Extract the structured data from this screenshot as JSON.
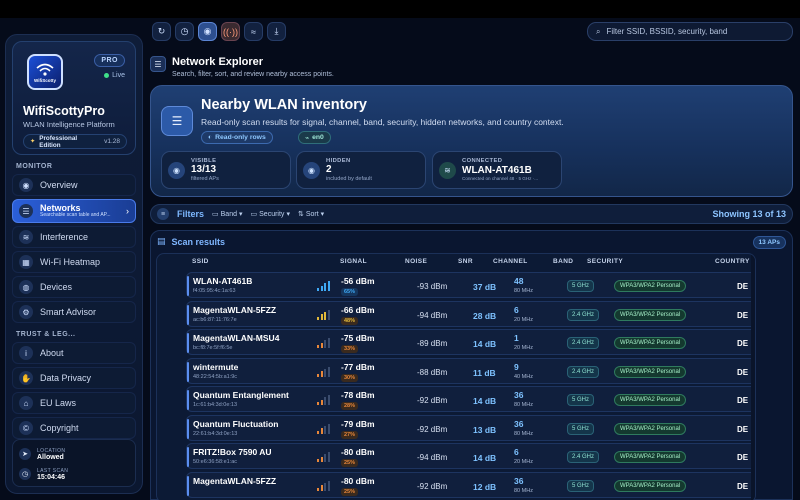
{
  "app": {
    "name": "WifiScottyPro",
    "subtitle": "WLAN Intelligence Platform",
    "icon_caption": "WifiScotty",
    "pro_badge": "PRO",
    "live": "Live",
    "edition": "Professional Edition",
    "version": "v1.28"
  },
  "sidebar": {
    "monitor_label": "MONITOR",
    "monitor_items": [
      {
        "label": "Overview",
        "icon": "eye-icon",
        "glyph": "◉"
      },
      {
        "label": "Networks",
        "sub": "Searchable scan table and AP...",
        "icon": "list-icon",
        "glyph": "☰",
        "active": true
      },
      {
        "label": "Interference",
        "icon": "wave-icon",
        "glyph": "≋"
      },
      {
        "label": "Wi-Fi Heatmap",
        "icon": "grid-icon",
        "glyph": "▦"
      },
      {
        "label": "Devices",
        "icon": "globe-icon",
        "glyph": "◍"
      },
      {
        "label": "Smart Advisor",
        "icon": "gear-icon",
        "glyph": "⚙"
      }
    ],
    "trust_label": "TRUST & LEG...",
    "trust_items": [
      {
        "label": "About",
        "icon": "info-icon",
        "glyph": "i"
      },
      {
        "label": "Data Privacy",
        "icon": "hand-icon",
        "glyph": "✋"
      },
      {
        "label": "EU Laws",
        "icon": "bank-icon",
        "glyph": "⌂"
      },
      {
        "label": "Copyright",
        "icon": "copyright-icon",
        "glyph": "©"
      }
    ],
    "location_key": "LOCATION",
    "location_value": "Allowed",
    "lastscan_key": "LAST SCAN",
    "lastscan_value": "15:04:46"
  },
  "toolbar": {
    "search_placeholder": "Filter SSID, BSSID, security, band"
  },
  "header": {
    "title": "Network Explorer",
    "subtitle": "Search, filter, sort, and review nearby access points."
  },
  "hero": {
    "title": "Nearby WLAN inventory",
    "subtitle": "Read-only scan results for signal, channel, band, security, hidden networks, and country context.",
    "chip_readonly": "Read-only rows",
    "chip_iface": "en0",
    "stats": {
      "visible": {
        "key": "VISIBLE",
        "value": "13/13",
        "note": "filtered APs"
      },
      "hidden": {
        "key": "HIDDEN",
        "value": "2",
        "note": "included by default"
      },
      "connected": {
        "key": "CONNECTED",
        "value": "WLAN-AT461B",
        "note": "Connected on channel 48 · 5 GHz ·..."
      }
    }
  },
  "filters": {
    "title": "Filters",
    "band": "Band",
    "security": "Security",
    "sort": "Sort",
    "showing": "Showing 13 of 13"
  },
  "results": {
    "title": "Scan results",
    "badge": "13 APs",
    "columns": {
      "ssid": "SSID",
      "signal": "SIGNAL",
      "noise": "NOISE",
      "snr": "SNR",
      "channel": "CHANNEL",
      "band": "BAND",
      "security": "SECURITY",
      "country": "COUNTRY"
    },
    "rows": [
      {
        "ssid": "WLAN-AT461B",
        "bssid": "f4:05:95:4c:1a:63",
        "dbm": "-56 dBm",
        "pct": "65%",
        "level": 0.65,
        "noise": "-93 dBm",
        "snr": "37 dB",
        "channel": "48",
        "mhz": "80 MHz",
        "band": "5 GHz",
        "security": "WPA3/WPA2 Personal",
        "country": "DE"
      },
      {
        "ssid": "MagentaWLAN-5FZZ",
        "bssid": "ac:b6:87:11:76:7e",
        "dbm": "-66 dBm",
        "pct": "48%",
        "level": 0.48,
        "noise": "-94 dBm",
        "snr": "28 dB",
        "channel": "6",
        "mhz": "20 MHz",
        "band": "2.4 GHz",
        "security": "WPA3/WPA2 Personal",
        "country": "DE"
      },
      {
        "ssid": "MagentaWLAN-MSU4",
        "bssid": "bc:f8:7e:5f:f6:5e",
        "dbm": "-75 dBm",
        "pct": "33%",
        "level": 0.33,
        "noise": "-89 dBm",
        "snr": "14 dB",
        "channel": "1",
        "mhz": "20 MHz",
        "band": "2.4 GHz",
        "security": "WPA3/WPA2 Personal",
        "country": "DE"
      },
      {
        "ssid": "wintermute",
        "bssid": "48:22:54:5b:a1:9c",
        "dbm": "-77 dBm",
        "pct": "30%",
        "level": 0.3,
        "noise": "-88 dBm",
        "snr": "11 dB",
        "channel": "9",
        "mhz": "40 MHz",
        "band": "2.4 GHz",
        "security": "WPA3/WPA2 Personal",
        "country": "DE"
      },
      {
        "ssid": "Quantum Entanglement",
        "bssid": "1c:61:b4:3d:0e:13",
        "dbm": "-78 dBm",
        "pct": "28%",
        "level": 0.28,
        "noise": "-92 dBm",
        "snr": "14 dB",
        "channel": "36",
        "mhz": "80 MHz",
        "band": "5 GHz",
        "security": "WPA3/WPA2 Personal",
        "country": "DE"
      },
      {
        "ssid": "Quantum Fluctuation",
        "bssid": "22:61:b4:3d:0e:13",
        "dbm": "-79 dBm",
        "pct": "27%",
        "level": 0.27,
        "noise": "-92 dBm",
        "snr": "13 dB",
        "channel": "36",
        "mhz": "80 MHz",
        "band": "5 GHz",
        "security": "WPA3/WPA2 Personal",
        "country": "DE"
      },
      {
        "ssid": "FRITZ!Box 7590 AU",
        "bssid": "50:e6:36:58:e1:ac",
        "dbm": "-80 dBm",
        "pct": "25%",
        "level": 0.25,
        "noise": "-94 dBm",
        "snr": "14 dB",
        "channel": "6",
        "mhz": "20 MHz",
        "band": "2.4 GHz",
        "security": "WPA3/WPA2 Personal",
        "country": "DE"
      },
      {
        "ssid": "MagentaWLAN-5FZZ",
        "bssid": "",
        "dbm": "-80 dBm",
        "pct": "25%",
        "level": 0.25,
        "noise": "-92 dBm",
        "snr": "12 dB",
        "channel": "36",
        "mhz": "80 MHz",
        "band": "5 GHz",
        "security": "WPA3/WPA2 Personal",
        "country": "DE"
      }
    ]
  },
  "colors": {
    "accent": "#2b5fd9",
    "good": "#3fa9f5",
    "mid": "#e2b93b",
    "weak": "#e8873a"
  }
}
